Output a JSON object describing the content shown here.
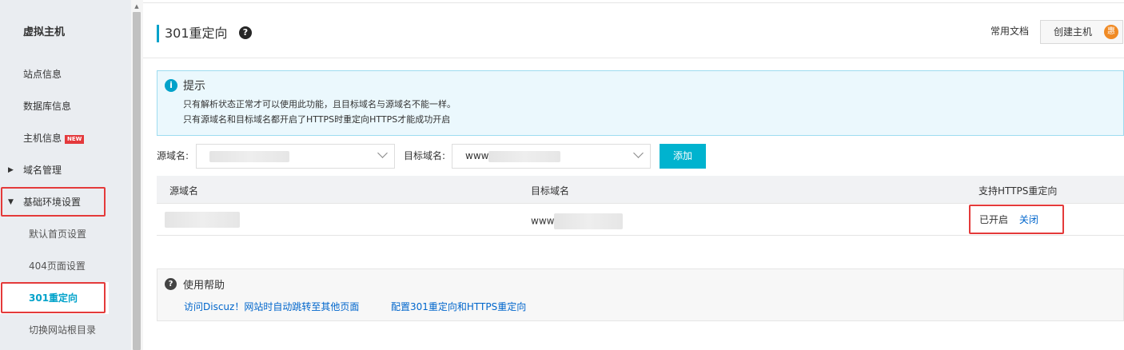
{
  "sidebar": {
    "title": "虚拟主机",
    "items": [
      {
        "label": "站点信息"
      },
      {
        "label": "数据库信息"
      },
      {
        "label": "主机信息",
        "badge": "NEW"
      },
      {
        "label": "域名管理"
      },
      {
        "label": "基础环境设置"
      },
      {
        "label": "默认首页设置"
      },
      {
        "label": "404页面设置"
      },
      {
        "label": "301重定向"
      },
      {
        "label": "切换网站根目录"
      }
    ]
  },
  "header": {
    "title": "301重定向",
    "help_icon": "?",
    "docs_link": "常用文档",
    "create_button": "创建主机",
    "create_badge": "惠"
  },
  "notice": {
    "icon": "i",
    "title": "提示",
    "line1": "只有解析状态正常才可以使用此功能，且目标域名与源域名不能一样。",
    "line2": "只有源域名和目标域名都开启了HTTPS时重定向HTTPS才能成功开启"
  },
  "form": {
    "source_label": "源域名:",
    "target_label": "目标域名:",
    "target_value_prefix": "www",
    "add_button": "添加"
  },
  "table": {
    "columns": [
      "源域名",
      "目标域名",
      "支持HTTPS重定向"
    ],
    "rows": [
      {
        "target_prefix": "www",
        "https_status": "已开启",
        "https_action": "关闭"
      }
    ]
  },
  "help": {
    "icon": "?",
    "title": "使用帮助",
    "links": [
      "访问Discuz！网站时自动跳转至其他页面",
      "配置301重定向和HTTPS重定向"
    ]
  },
  "colors": {
    "accent": "#00a2ca",
    "add_button": "#00b3cf",
    "highlight_box": "#e43a3a",
    "link": "#0066cc"
  }
}
